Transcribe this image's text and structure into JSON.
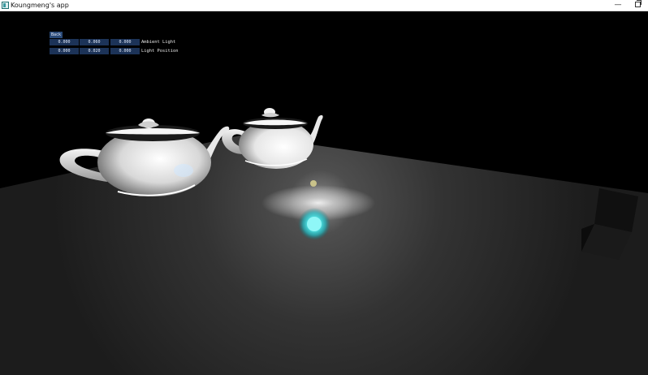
{
  "window": {
    "title": "Koungmeng's app",
    "icon": "app-window-icon",
    "minimize_glyph": "—",
    "restore_icon": "restore-icon"
  },
  "gui": {
    "back_label": "Back",
    "ambient_light": {
      "label": "Ambient Light",
      "values": [
        "0.000",
        "0.060",
        "0.000"
      ]
    },
    "light_position": {
      "label": "Light Position",
      "values": [
        "0.000",
        "0.020",
        "0.000"
      ]
    }
  },
  "scene": {
    "background": "#000000",
    "floor_color": "#2a2a2a",
    "teapot_color": "#ffffff",
    "light_sphere_color": "#58f0f0"
  }
}
